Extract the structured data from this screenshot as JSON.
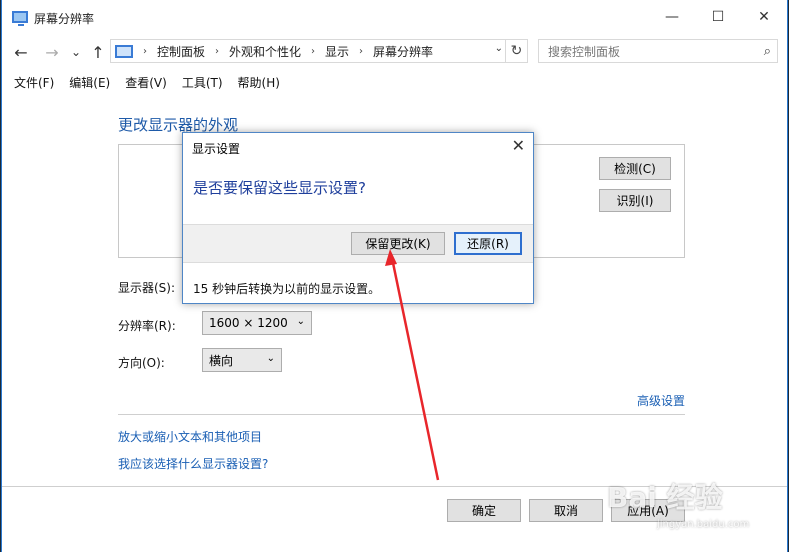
{
  "window": {
    "title": "屏幕分辨率"
  },
  "titlebar": {
    "minimize": "—",
    "maximize": "☐",
    "close": "✕"
  },
  "nav": {
    "back": "←",
    "forward": "→",
    "recent": "⌄",
    "up": "↑"
  },
  "breadcrumb": [
    "控制面板",
    "外观和个性化",
    "显示",
    "屏幕分辨率"
  ],
  "search": {
    "placeholder": "搜索控制面板"
  },
  "menu": [
    "文件(F)",
    "编辑(E)",
    "查看(V)",
    "工具(T)",
    "帮助(H)"
  ],
  "main": {
    "heading": "更改显示器的外观",
    "detect_button": "检测(C)",
    "identify_button": "识别(I)",
    "display_label": "显示器(S):",
    "resolution_label": "分辨率(R):",
    "resolution_value": "1600 × 1200",
    "orientation_label": "方向(O):",
    "orientation_value": "横向",
    "advanced_link": "高级设置",
    "text_size_link": "放大或缩小文本和其他项目",
    "which_settings_link": "我应该选择什么显示器设置?",
    "ok_button": "确定",
    "cancel_button": "取消",
    "apply_button": "应用(A)"
  },
  "dialog": {
    "title": "显示设置",
    "question": "是否要保留这些显示设置?",
    "keep_button": "保留更改(K)",
    "revert_button": "还原(R)",
    "countdown_text": "15 秒钟后转换为以前的显示设置。"
  },
  "watermark": {
    "brand": "Bai 经验",
    "sub": "jingyan.baidu.com"
  },
  "colors": {
    "accent": "#1a5fb4",
    "arrow": "#e8262b",
    "dialog_question": "#1f3f9c"
  }
}
